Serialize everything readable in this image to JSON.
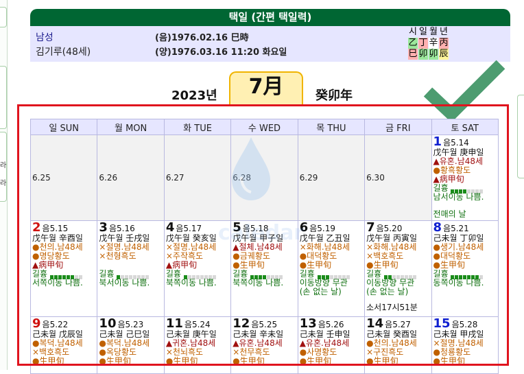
{
  "title": "택일 (간편 택일력)",
  "person": {
    "name": "남성",
    "name_age": "김기루(48세)",
    "lunar": "(음)1976.02.16 巳時",
    "solar": "(양)1976.03.16 11:20 화요일"
  },
  "pillars": {
    "labels": [
      "시",
      "일",
      "월",
      "년"
    ],
    "stems": [
      "乙",
      "丁",
      "辛",
      "丙"
    ],
    "branches": [
      "巳",
      "卯",
      "卯",
      "辰"
    ]
  },
  "year": "2023년",
  "month": "7月",
  "year_ganji": "癸卯年",
  "weekdays": [
    "일 SUN",
    "월 MON",
    "화 TUE",
    "수 WED",
    "목 THU",
    "금 FRI",
    "토 SAT"
  ],
  "prev_dates": [
    "6.25",
    "6.26",
    "6.27",
    "6.28",
    "6.29",
    "6.30"
  ],
  "watermark": "caledar",
  "colors": {
    "header_green": "#006633",
    "info_bg": "#e6e6ff",
    "frame_red": "#e0141e",
    "check_green": "#2e8b57",
    "sunday_red": "#d01010",
    "saturday_blue": "#1020d0"
  },
  "days": {
    "d1": {
      "num": "1",
      "lunar": "음5.14",
      "ganji": "戊午월 庚申일",
      "l1": "▲유혼.남48세",
      "l2": "●황흑황도",
      "l3": "▲病甲旬",
      "luck": "길흉",
      "luck_level": 4,
      "dir": "남서이동 나쁨.",
      "extra": "전매의 날"
    },
    "d2": {
      "num": "2",
      "lunar": "음5.15",
      "ganji": "戊午월 辛酉일",
      "l1": "●천의.남48세",
      "l2": "●명당황도",
      "l3": "▲病甲旬",
      "luck": "길흉",
      "luck_level": 6,
      "dir": "서쪽이동 나쁨."
    },
    "d3": {
      "num": "3",
      "lunar": "음5.16",
      "ganji": "戊午월 壬戌일",
      "l1": "×절명.남48세",
      "l2": "×천형흑도",
      "luck": "길흉",
      "luck_level": 1,
      "dir": "북서이동 나쁨."
    },
    "d4": {
      "num": "4",
      "lunar": "음5.17",
      "ganji": "戊午월 癸亥일",
      "l1": "×절명.남48세",
      "l2": "×주작흑도",
      "l3": "▲病甲旬",
      "luck": "길흉",
      "luck_level": 1,
      "dir": "북쪽이동 나쁨."
    },
    "d5": {
      "num": "5",
      "lunar": "음5.18",
      "ganji": "戊午월 甲子일",
      "l1": "▲절체.남48세",
      "l2": "●금궤황도",
      "l3": "●生甲旬",
      "luck": "길흉",
      "luck_level": 4,
      "dir": "북쪽이동 나쁨."
    },
    "d6": {
      "num": "6",
      "lunar": "음5.19",
      "ganji": "戊午월 乙丑일",
      "l1": "×화해.남48세",
      "l2": "●대덕황도",
      "l3": "●生甲旬",
      "luck": "길흉",
      "luck_level": 3,
      "dir": "이동방향 무관",
      "dir2": "(손 없는 날)"
    },
    "d7": {
      "num": "7",
      "lunar": "음5.20",
      "ganji": "戊午월 丙寅일",
      "l1": "×화해.남48세",
      "l2": "×백호흑도",
      "l3": "●生甲旬",
      "luck": "길흉",
      "luck_level": 2,
      "dir": "이동방향 무관",
      "dir2": "(손 없는 날)",
      "sunset": "소서17시51분"
    },
    "d8": {
      "num": "8",
      "lunar": "음5.21",
      "ganji": "己未월 丁卯일",
      "l1": "●생기.남48세",
      "l2": "●대덕황도",
      "l3": "●生甲旬",
      "luck": "길흉",
      "luck_level": 7,
      "dir": "동쪽이동 나쁨."
    },
    "d9": {
      "num": "9",
      "lunar": "음5.22",
      "ganji": "己未월 戊辰일",
      "l1": "●복덕.남48세",
      "l2": "×백호흑도",
      "l3": "●生甲旬"
    },
    "d10": {
      "num": "10",
      "lunar": "음5.23",
      "ganji": "己未월 己巳일",
      "l1": "●복덕.남48세",
      "l2": "●옥당황도",
      "l3": "●生甲旬"
    },
    "d11": {
      "num": "11",
      "lunar": "음5.24",
      "ganji": "己未월 庚午일",
      "l1": "▲귀혼.남48세",
      "l2": "×천뇌흑도",
      "l3": "●生甲旬"
    },
    "d12": {
      "num": "12",
      "lunar": "음5.25",
      "ganji": "己未월 辛未일",
      "l1": "▲유혼.남48세",
      "l2": "×천무흑도",
      "l3": "●生甲旬"
    },
    "d13": {
      "num": "13",
      "lunar": "음5.26",
      "ganji": "己未월 壬申일",
      "l1": "▲유혼.남48세",
      "l2": "●사명황도",
      "l3": "●生甲旬"
    },
    "d14": {
      "num": "14",
      "lunar": "음5.27",
      "ganji": "己未월 癸酉일",
      "l1": "●천의.남48세",
      "l2": "×구진흑도",
      "l3": "●生甲旬"
    },
    "d15": {
      "num": "15",
      "lunar": "음5.28",
      "ganji": "己未월 甲戌일",
      "l1": "×절명.남48세",
      "l2": "●청룡황도",
      "l3": "●生甲旬"
    }
  }
}
